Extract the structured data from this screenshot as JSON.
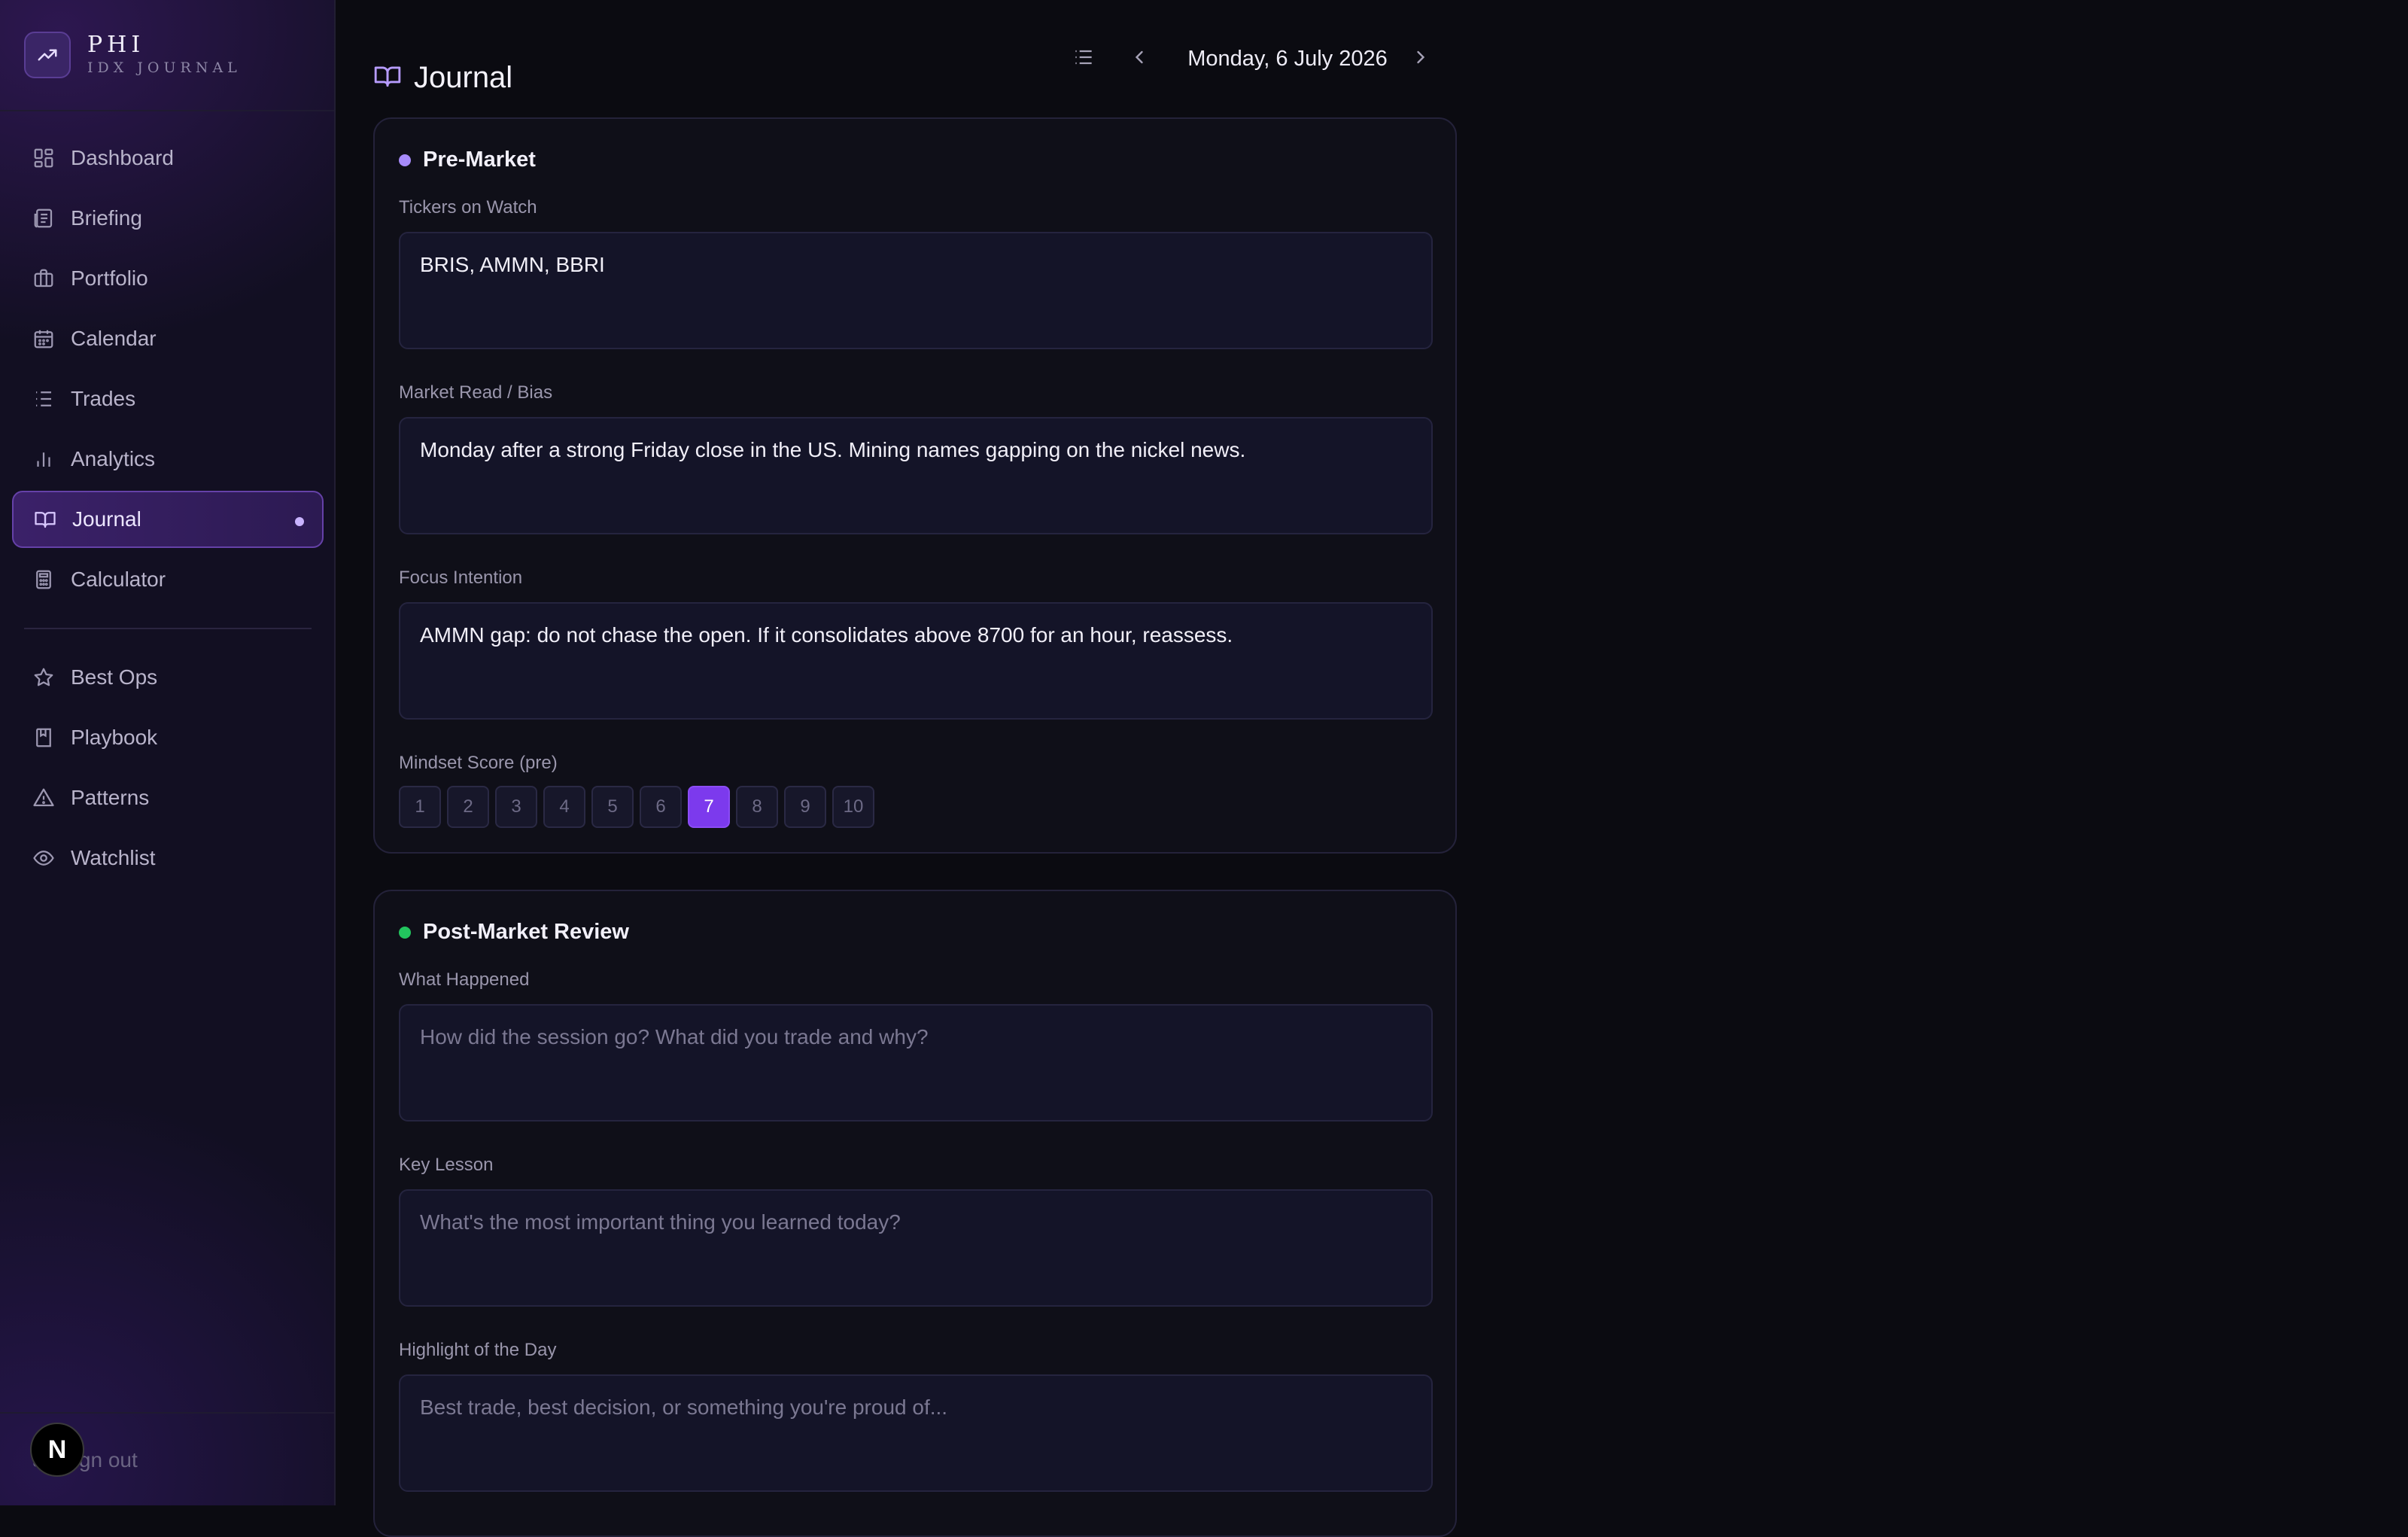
{
  "brand": {
    "name": "PHI",
    "subtitle": "IDX JOURNAL"
  },
  "nav": {
    "primary": [
      {
        "label": "Dashboard",
        "icon": "grid-icon"
      },
      {
        "label": "Briefing",
        "icon": "newspaper-icon"
      },
      {
        "label": "Portfolio",
        "icon": "briefcase-icon"
      },
      {
        "label": "Calendar",
        "icon": "calendar-icon"
      },
      {
        "label": "Trades",
        "icon": "list-icon"
      },
      {
        "label": "Analytics",
        "icon": "bar-chart-icon"
      },
      {
        "label": "Journal",
        "icon": "book-open-icon",
        "active": true
      },
      {
        "label": "Calculator",
        "icon": "calculator-icon"
      }
    ],
    "secondary": [
      {
        "label": "Best Ops",
        "icon": "star-icon"
      },
      {
        "label": "Playbook",
        "icon": "bookmark-book-icon"
      },
      {
        "label": "Patterns",
        "icon": "warning-triangle-icon"
      },
      {
        "label": "Watchlist",
        "icon": "eye-icon"
      }
    ],
    "signout_label": "Sign out",
    "badge_letter": "N"
  },
  "header": {
    "title": "Journal",
    "date": "Monday, 6 July 2026"
  },
  "pre_market": {
    "title": "Pre-Market",
    "dot_color": "#a78bfa",
    "fields": {
      "tickers": {
        "label": "Tickers on Watch",
        "value": "BRIS, AMMN, BBRI"
      },
      "bias": {
        "label": "Market Read / Bias",
        "value": "Monday after a strong Friday close in the US. Mining names gapping on the nickel news."
      },
      "focus": {
        "label": "Focus Intention",
        "value": "AMMN gap: do not chase the open. If it consolidates above 8700 for an hour, reassess."
      }
    },
    "mindset": {
      "label": "Mindset Score (pre)",
      "options": [
        "1",
        "2",
        "3",
        "4",
        "5",
        "6",
        "7",
        "8",
        "9",
        "10"
      ],
      "selected": 7
    }
  },
  "post_market": {
    "title": "Post-Market Review",
    "dot_color": "#22c55e",
    "fields": {
      "what_happened": {
        "label": "What Happened",
        "placeholder": "How did the session go? What did you trade and why?"
      },
      "key_lesson": {
        "label": "Key Lesson",
        "placeholder": "What's the most important thing you learned today?"
      },
      "highlight": {
        "label": "Highlight of the Day",
        "placeholder": "Best trade, best decision, or something you're proud of..."
      }
    }
  },
  "colors": {
    "accent": "#7c3aed",
    "background": "#0b0b11",
    "sidebar": "#120f22"
  }
}
